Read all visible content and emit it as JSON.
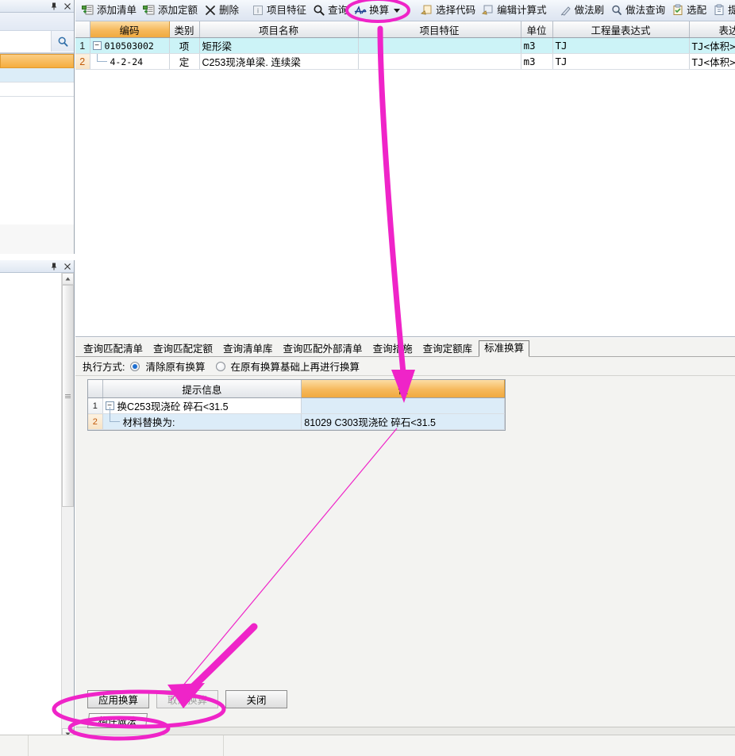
{
  "toolbar": {
    "items": [
      {
        "icon": "add-list-icon",
        "label": "添加清单",
        "type": "button"
      },
      {
        "icon": "add-quota-icon",
        "label": "添加定额",
        "type": "button"
      },
      {
        "icon": "delete-icon",
        "label": "删除",
        "type": "button"
      },
      {
        "icon": "separator",
        "label": "",
        "type": "sep"
      },
      {
        "icon": "project-feature-icon",
        "label": "项目特征",
        "type": "button"
      },
      {
        "icon": "search-icon",
        "label": "查询",
        "type": "button"
      },
      {
        "icon": "convert-icon",
        "label": "换算",
        "type": "dropdown"
      },
      {
        "icon": "select-code-icon",
        "label": "选择代码",
        "type": "button"
      },
      {
        "icon": "edit-formula-icon",
        "label": "编辑计算式",
        "type": "button"
      },
      {
        "icon": "separator",
        "label": "",
        "type": "sep"
      },
      {
        "icon": "method-brush-icon",
        "label": "做法刷",
        "type": "button"
      },
      {
        "icon": "method-query-icon",
        "label": "做法查询",
        "type": "button"
      },
      {
        "icon": "select-match-icon",
        "label": "选配",
        "type": "button"
      },
      {
        "icon": "extract-method-icon",
        "label": "提取做法",
        "type": "button"
      }
    ]
  },
  "grid": {
    "columns": [
      "编码",
      "类别",
      "项目名称",
      "项目特征",
      "单位",
      "工程量表达式",
      "表达"
    ],
    "rows": [
      {
        "no": "1",
        "code": "010503002",
        "category": "项",
        "name": "矩形梁",
        "feature": "",
        "unit": "m3",
        "expr": "TJ",
        "desc": "TJ<体积>",
        "selected": true,
        "level": 0
      },
      {
        "no": "2",
        "code": "4-2-24",
        "category": "定",
        "name": "C253现浇单梁. 连续梁",
        "feature": "",
        "unit": "m3",
        "expr": "TJ",
        "desc": "TJ<体积>",
        "selected": false,
        "level": 1
      }
    ]
  },
  "lower": {
    "tabs": [
      {
        "label": "查询匹配清单",
        "active": false
      },
      {
        "label": "查询匹配定额",
        "active": false
      },
      {
        "label": "查询清单库",
        "active": false
      },
      {
        "label": "查询匹配外部清单",
        "active": false
      },
      {
        "label": "查询措施",
        "active": false
      },
      {
        "label": "查询定额库",
        "active": false
      },
      {
        "label": "标准换算",
        "active": true
      }
    ],
    "exec_label": "执行方式:",
    "options": [
      {
        "label": "清除原有换算",
        "selected": true
      },
      {
        "label": "在原有换算基础上再进行换算",
        "selected": false
      }
    ],
    "conv_columns": [
      "提示信息",
      "值"
    ],
    "conv_rows": [
      {
        "no": "1",
        "info": "换C253现浇砼 碎石<31.5",
        "value": "",
        "level": 0
      },
      {
        "no": "2",
        "info": "材料替换为:",
        "value": "81029   C303现浇砼 碎石<31.5",
        "level": 1
      }
    ],
    "buttons": [
      {
        "label": "应用换算",
        "disabled": false
      },
      {
        "label": "取消换算",
        "disabled": true
      },
      {
        "label": "关闭",
        "disabled": false
      }
    ],
    "bottom_tab": "构件做法"
  },
  "left_panel": {
    "search_value": "",
    "search_placeholder": ""
  },
  "colors": {
    "annotation": "#ef24c8",
    "accent_orange": "#f2ad45",
    "selection_cyan": "#ccf3f7",
    "selection_blue": "#dcecf8"
  }
}
